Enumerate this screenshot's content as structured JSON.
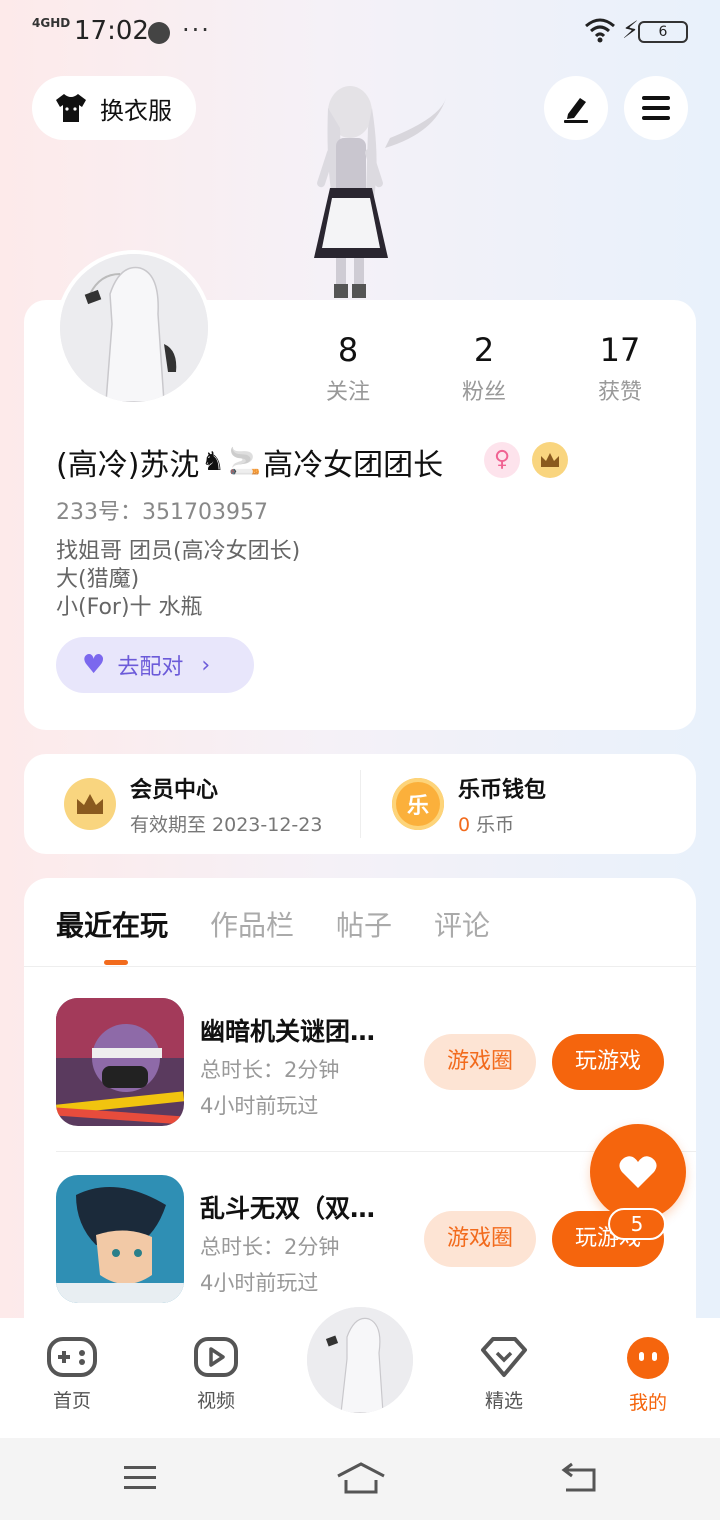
{
  "status_bar": {
    "network": "4GHD",
    "time": "17:02",
    "more": "···",
    "battery": "6"
  },
  "top": {
    "outfit_label": "换衣服"
  },
  "profile": {
    "stats": [
      {
        "num": "8",
        "label": "关注"
      },
      {
        "num": "2",
        "label": "粉丝"
      },
      {
        "num": "17",
        "label": "获赞"
      }
    ],
    "nickname_part1": "(高冷)苏沈",
    "nickname_emoji1": "♞",
    "nickname_emoji2": "🚬",
    "nickname_part2": "高冷女团团长",
    "gender_badge": "♀",
    "uid": "233号：351703957",
    "bio_lines": [
      "找姐哥 团员(高冷女团长)",
      "大(猎魔)",
      "小(For)十 水瓶"
    ],
    "match_label": "去配对"
  },
  "member": {
    "vip_title": "会员中心",
    "vip_sub": "有效期至 2023-12-23",
    "wallet_title": "乐币钱包",
    "wallet_icon_text": "乐",
    "wallet_amount": "0",
    "wallet_unit": " 乐币"
  },
  "tabs": [
    "最近在玩",
    "作品栏",
    "帖子",
    "评论"
  ],
  "games": [
    {
      "title": "幽暗机关谜团…",
      "duration": "总时长：2分钟",
      "last_played": "4小时前玩过",
      "circle_label": "游戏圈",
      "play_label": "玩游戏"
    },
    {
      "title": "乱斗无双（双…",
      "duration": "总时长：2分钟",
      "last_played": "4小时前玩过",
      "circle_label": "游戏圈",
      "play_label": "玩游戏"
    }
  ],
  "float": {
    "count": "5"
  },
  "bottom_nav": [
    {
      "label": "首页"
    },
    {
      "label": "视频"
    },
    {
      "label": "精选"
    },
    {
      "label": "我的"
    }
  ],
  "colors": {
    "accent": "#f5650d",
    "purple": "#6b5ad9"
  }
}
